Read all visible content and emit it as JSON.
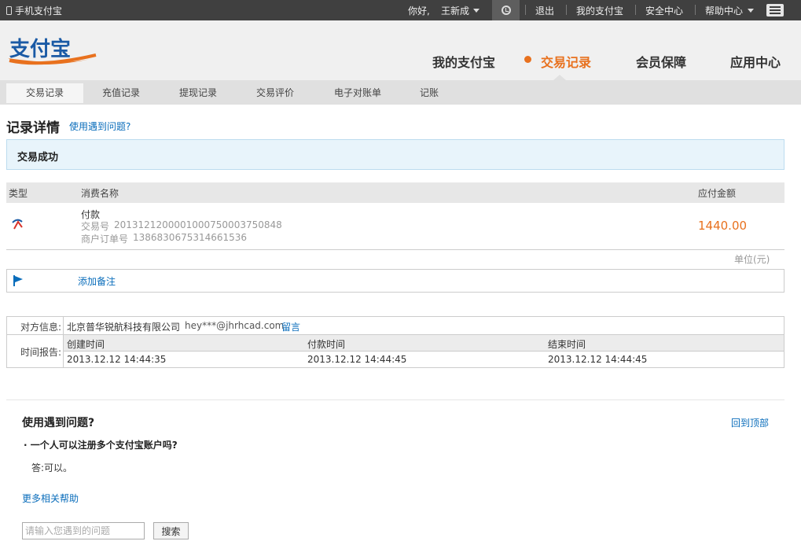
{
  "topbar": {
    "mobile_label": "手机支付宝",
    "greeting": "你好,",
    "username": "王新成",
    "logout": "退出",
    "my_alipay": "我的支付宝",
    "security": "安全中心",
    "help": "帮助中心"
  },
  "header": {
    "logo_text": "支付宝",
    "nav": {
      "my_alipay": "我的支付宝",
      "records": "交易记录",
      "member": "会员保障",
      "apps": "应用中心"
    }
  },
  "subnav": {
    "tabs": [
      "交易记录",
      "充值记录",
      "提现记录",
      "交易评价",
      "电子对账单",
      "记账"
    ]
  },
  "detail": {
    "title": "记录详情",
    "help_link": "使用遇到问题?",
    "status": "交易成功",
    "columns": {
      "type": "类型",
      "name": "消费名称",
      "amount": "应付金额"
    },
    "row": {
      "name": "付款",
      "trade_no_label": "交易号",
      "trade_no": "20131212000010007500037508​48",
      "order_no_label": "商户订单号",
      "order_no": "1386830675314661536",
      "amount": "1440.00"
    },
    "unit": "单位(元)",
    "add_note": "添加备注"
  },
  "info": {
    "party_label": "对方信息:",
    "company": "北京普华锐航科技有限公司",
    "email": "hey***@jhrhcad.com",
    "message": "留言",
    "time_label": "时间报告:",
    "created_label": "创建时间",
    "paid_label": "付款时间",
    "finished_label": "结束时间",
    "created": "2013.12.12 14:44:35",
    "paid": "2013.12.12 14:44:45",
    "finished": "2013.12.12 14:44:45"
  },
  "faq": {
    "title": "使用遇到问题?",
    "back_top": "回到顶部",
    "question": "· 一个人可以注册多个支付宝账户吗?",
    "answer": "答:可以。",
    "more_help": "更多相关帮助",
    "search_placeholder": "请输入您遇到的问题",
    "search_button": "搜索"
  },
  "colors": {
    "topbar": "#404040",
    "accent": "#e8711e",
    "link": "#0a6dbb"
  }
}
